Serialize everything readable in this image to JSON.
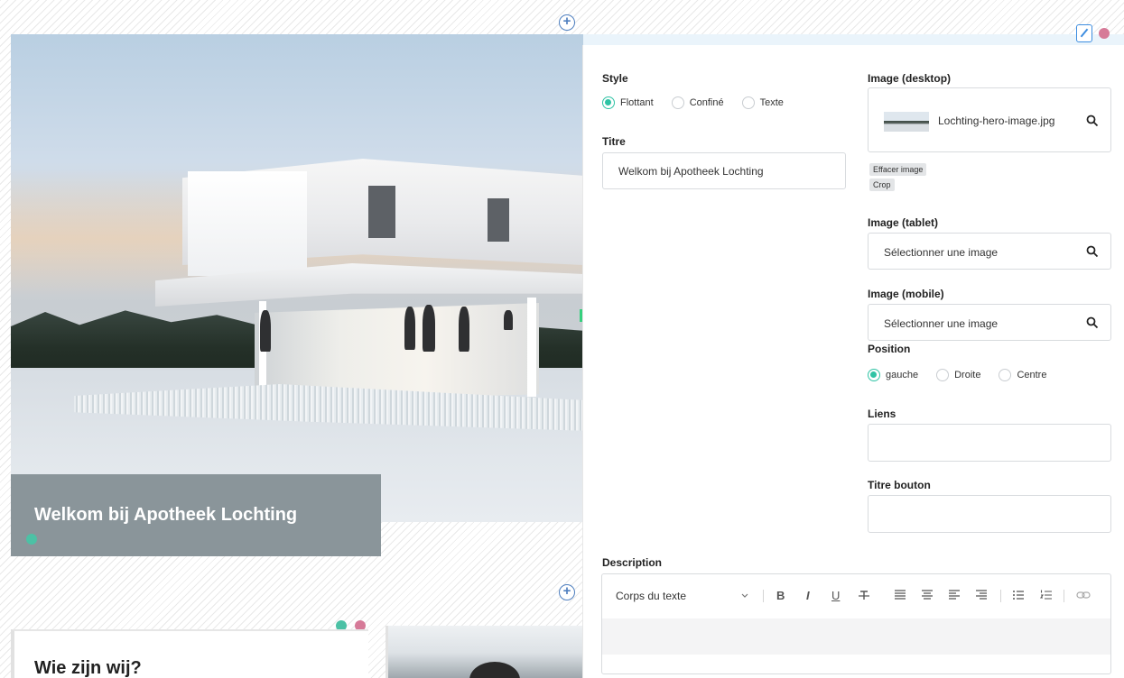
{
  "canvas": {
    "hero_caption": "Welkom bij Apotheek Lochting",
    "section_title": "Wie zijn wij?",
    "add_symbol": "+"
  },
  "panel": {
    "style": {
      "label": "Style",
      "options": [
        "Flottant",
        "Confiné",
        "Texte"
      ],
      "selected": "Flottant"
    },
    "title": {
      "label": "Titre",
      "value": "Welkom bij Apotheek Lochting"
    },
    "image_desktop": {
      "label": "Image (desktop)",
      "filename": "Lochting-hero-image.jpg",
      "clear_label": "Effacer image",
      "crop_label": "Crop"
    },
    "image_tablet": {
      "label": "Image (tablet)",
      "placeholder": "Sélectionner une image"
    },
    "image_mobile": {
      "label": "Image (mobile)",
      "placeholder": "Sélectionner une image"
    },
    "position": {
      "label": "Position",
      "options": [
        "gauche",
        "Droite",
        "Centre"
      ],
      "selected": "gauche"
    },
    "links": {
      "label": "Liens",
      "value": ""
    },
    "button_title": {
      "label": "Titre bouton",
      "value": ""
    },
    "description": {
      "label": "Description",
      "format_select": "Corps du texte",
      "bold": "B",
      "italic": "I",
      "underline": "U",
      "value": ""
    }
  },
  "colors": {
    "accent_teal": "#2fc3a4",
    "marker_pink": "#d67a98",
    "edit_blue": "#3d8de0",
    "caption_bg": "#8a959a"
  }
}
